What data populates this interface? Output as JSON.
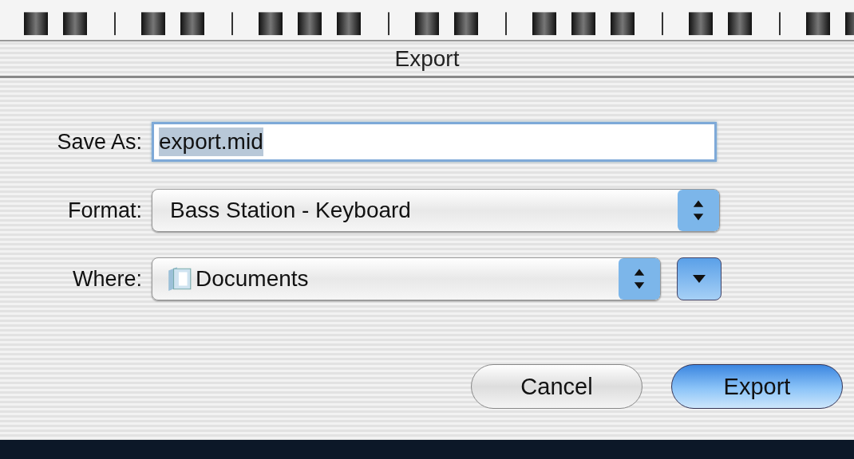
{
  "window": {
    "title": "Export"
  },
  "fields": [
    {
      "kind": "text",
      "label": "Save As:",
      "value": "export.mid",
      "value_selected": true
    },
    {
      "kind": "popup",
      "label": "Format:",
      "value": "Bass Station - Keyboard"
    },
    {
      "kind": "folder",
      "label": "Where:",
      "value": "Documents",
      "expanded": false
    }
  ],
  "buttons": [
    {
      "label": "Cancel",
      "default": false
    },
    {
      "label": "Export",
      "default": true
    }
  ]
}
